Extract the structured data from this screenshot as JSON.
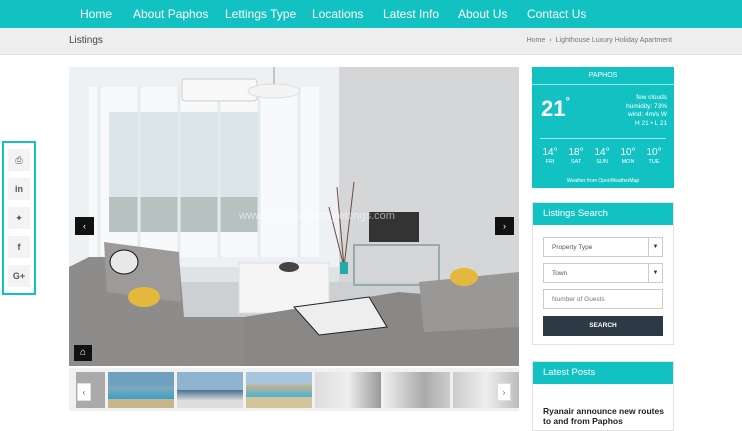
{
  "nav": {
    "items": [
      "Home",
      "About Paphos",
      "Lettings Type",
      "Locations",
      "Latest Info",
      "About Us",
      "Contact Us"
    ]
  },
  "page": {
    "title": "Listings"
  },
  "breadcrumb": {
    "home": "Home",
    "sep": "›",
    "current": "Lighthouse Luxury Holiday Apartment"
  },
  "gallery": {
    "watermark": "www.paphosholidaylettings.com",
    "prev": "‹",
    "next": "›"
  },
  "share": {
    "icons": [
      "print-icon",
      "linkedin-icon",
      "twitter-icon",
      "facebook-icon",
      "google-plus-icon"
    ]
  },
  "weather": {
    "city": "PAPHOS",
    "temp": "21",
    "deg": "°",
    "conditions": "few clouds",
    "humidity": "humidity: 73%",
    "wind": "wind: 4m/s W",
    "hilo": "H 21 • L 21",
    "forecast": [
      {
        "temp": "14",
        "day": "FRI"
      },
      {
        "temp": "18",
        "day": "SAT"
      },
      {
        "temp": "14",
        "day": "SUN"
      },
      {
        "temp": "10",
        "day": "MON"
      },
      {
        "temp": "10",
        "day": "TUE"
      }
    ],
    "credit": "Weather from OpenWeatherMap"
  },
  "search": {
    "title": "Listings Search",
    "property_type": "Property Type",
    "town": "Town",
    "guests_placeholder": "Number of Guests",
    "button": "SEARCH"
  },
  "posts": {
    "title": "Latest Posts",
    "first": "Ryanair announce new routes to and from Paphos"
  },
  "colors": {
    "accent": "#12c2c2",
    "dark": "#2d3a45"
  }
}
